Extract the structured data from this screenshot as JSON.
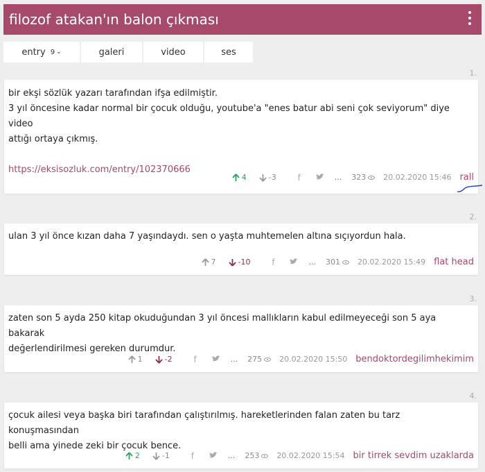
{
  "header": {
    "title": "filozof atakan'ın balon çıkması"
  },
  "tabs": [
    {
      "label": "entry",
      "count": "9",
      "chevron": "⌄"
    },
    {
      "label": "galeri"
    },
    {
      "label": "video"
    },
    {
      "label": "ses"
    }
  ],
  "entries": [
    {
      "no": "1.",
      "lines": [
        "bir ekşi sözlük yazarı tarafından ifşa edilmiştir.",
        "3 yıl öncesine kadar normal bir çocuk olduğu, youtube'a \"enes batur abi seni çok seviyorum\" diye video",
        "attığı ortaya çıkmış."
      ],
      "link": "https://eksisozluk.com/entry/102370666",
      "up": "4",
      "down": "-3",
      "views": "323",
      "date": "20.02.2020 15:46",
      "author": "rall"
    },
    {
      "no": "2.",
      "lines": [
        "ulan 3 yıl önce kızan daha 7 yaşındaydı. sen o yaşta muhtemelen altına sıçıyordun hala."
      ],
      "up": "7",
      "down": "-10",
      "views": "301",
      "date": "20.02.2020 15:49",
      "author": "flat head"
    },
    {
      "no": "3.",
      "lines": [
        "zaten son 5 ayda 250 kitap okuduğundan 3 yıl öncesi mallıkların kabul edilmeyeceği son 5 aya bakarak",
        "değerlendirilmesi gereken durumdur."
      ],
      "up": "1",
      "down": "-2",
      "views": "275",
      "date": "20.02.2020 15:50",
      "author": "bendoktordegilimhekimim"
    },
    {
      "no": "4.",
      "lines": [
        "çocuk ailesi veya başka biri tarafından çalıştırılmış. hareketlerinden falan zaten bu tarz konuşmasından",
        "belli ama yinede zeki bir çocuk bence."
      ],
      "up": "2",
      "down": "-1",
      "views": "253",
      "date": "20.02.2020 15:54",
      "author": "bir tirrek sevdim uzaklarda"
    }
  ],
  "icons": {
    "up": "arrow-up-icon",
    "down": "arrow-down-icon",
    "facebook": "facebook-icon",
    "twitter": "twitter-icon",
    "views": "eye-icon"
  },
  "colors": {
    "brand": "#a6496a",
    "up_active": "#2ea05f",
    "down_active": "#8b2f4e"
  },
  "more_label": "..."
}
